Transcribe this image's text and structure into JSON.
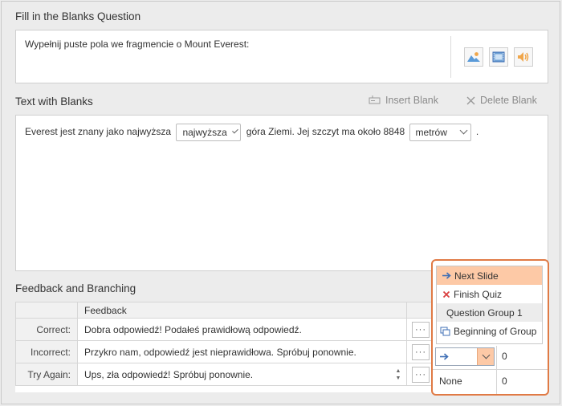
{
  "question": {
    "section_title": "Fill in the Blanks Question",
    "text": "Wypełnij puste pola we fragmencie o Mount Everest:",
    "media_buttons": [
      {
        "icon": "image-icon"
      },
      {
        "icon": "video-icon"
      },
      {
        "icon": "audio-icon"
      }
    ]
  },
  "blanks": {
    "section_title": "Text with Blanks",
    "insert_blank_label": "Insert Blank",
    "delete_blank_label": "Delete Blank",
    "text_part1": "Everest jest znany jako najwyższa",
    "blank1_value": "najwyższa",
    "text_part2": "góra Ziemi. Jej szczyt ma około 8848",
    "blank2_value": "metrów",
    "text_part3": "."
  },
  "feedback": {
    "section_title": "Feedback and Branching",
    "column_header": "Feedback",
    "rows": [
      {
        "label": "Correct:",
        "text": "Dobra odpowiedź! Podałeś prawidłową odpowiedź.",
        "branch": "",
        "score": ""
      },
      {
        "label": "Incorrect:",
        "text": "Przykro nam, odpowiedź jest nieprawidłowa. Spróbuj ponownie.",
        "branch": "",
        "score": "0"
      },
      {
        "label": "Try Again:",
        "text": "Ups, zła odpowiedź! Spróbuj ponownie.",
        "branch": "None",
        "score": "0"
      }
    ],
    "more_label": "···"
  },
  "branch_dropdown": {
    "options": [
      {
        "label": "Next Slide",
        "icon": "arrow-right-icon"
      },
      {
        "label": "Finish Quiz",
        "icon": "close-icon"
      },
      {
        "label": "Question Group 1",
        "icon": ""
      },
      {
        "label": "Beginning of Group",
        "icon": "group-icon"
      }
    ],
    "highlighted_index": 0
  },
  "colors": {
    "accent_orange": "#e07a45",
    "highlight": "#fdc9a6",
    "blue_arrow": "#3f6fb5",
    "red_x": "#d94040"
  }
}
